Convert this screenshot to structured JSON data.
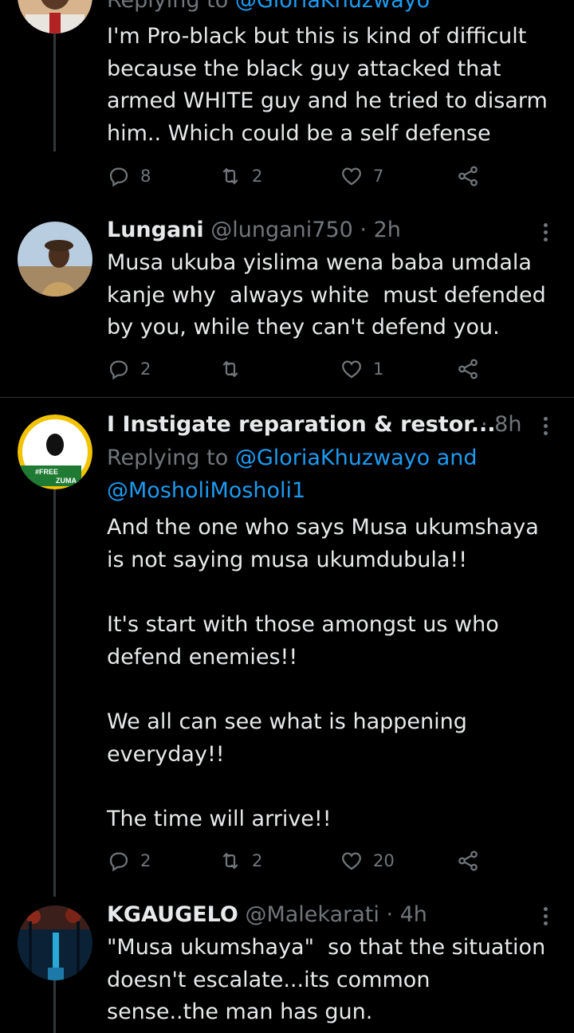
{
  "tweets": [
    {
      "reply_prefix": "Replying to",
      "reply_handles": "@GloriaKhuzwayo",
      "text": "I'm Pro-black but this is kind of difficult\nbecause the black guy attacked that\narmed WHITE guy and he tried to disarm\nhim.. Which could be a self defense",
      "replies": "8",
      "retweets": "2",
      "likes": "7"
    },
    {
      "name": "Lungani",
      "handle": "@lungani750",
      "time": "· 2h",
      "text": "Musa ukuba yislima wena baba umdala\nkanje why  always white  must defended\nby you, while they can't defend you.",
      "replies": "2",
      "retweets": "",
      "likes": "1"
    },
    {
      "name": "I Instigate reparation & restor...",
      "time": "· 8h",
      "reply_prefix": "Replying to",
      "reply_handles": "@GloriaKhuzwayo and",
      "reply_handles_2": "@MosholiMosholi1",
      "avatar_badge_1": "#FREE",
      "avatar_badge_2": "ZUMA",
      "text": "And the one who says Musa ukumshaya\nis not saying musa ukumdubula!!\n\nIt's start with those amongst us who\ndefend enemies!!\n\nWe all can see what is happening\neveryday!!\n\nThe time will arrive!!",
      "replies": "2",
      "retweets": "2",
      "likes": "20"
    },
    {
      "name": "KGAUGELO",
      "handle": "@Malekarati",
      "time": "· 4h",
      "text": "\"Musa ukumshaya\"  so that the situation\ndoesn't escalate...its common\nsense..the man has gun."
    }
  ],
  "icons": [
    "reply-icon",
    "retweet-icon",
    "like-icon",
    "share-icon",
    "more-icon"
  ],
  "colors": {
    "background": "#000000",
    "text": "#e7e9ea",
    "muted": "#71767b",
    "link": "#1d9bf0",
    "divider": "#2f3336"
  }
}
